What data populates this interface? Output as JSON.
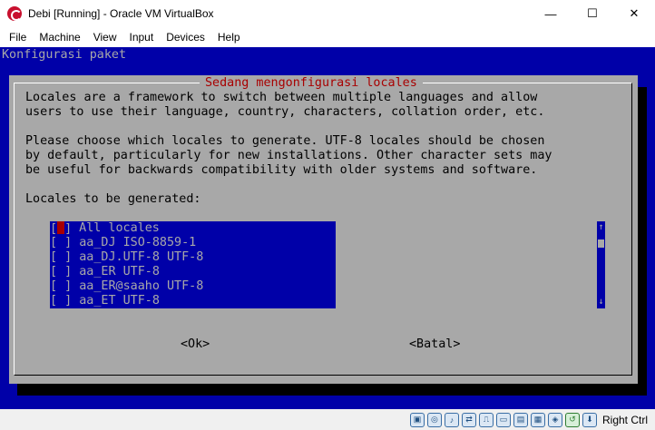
{
  "window": {
    "title": "Debi [Running] - Oracle VM VirtualBox",
    "controls": {
      "minimize": "—",
      "maximize": "☐",
      "close": "✕"
    }
  },
  "menubar": {
    "items": [
      {
        "label": "File"
      },
      {
        "label": "Machine"
      },
      {
        "label": "View"
      },
      {
        "label": "Input"
      },
      {
        "label": "Devices"
      },
      {
        "label": "Help"
      }
    ]
  },
  "vm": {
    "header": "Konfigurasi paket",
    "dialog": {
      "title": "Sedang mengonfigurasi locales",
      "lines": [
        "Locales are a framework to switch between multiple languages and allow",
        "users to use their language, country, characters, collation order, etc.",
        "",
        "Please choose which locales to generate. UTF-8 locales should be chosen",
        "by default, particularly for new installations. Other character sets may",
        "be useful for backwards compatibility with older systems and software.",
        "",
        "Locales to be generated:"
      ],
      "locales": [
        {
          "checkbox_left": "[",
          "checkbox_right": "]",
          "label": " All locales",
          "cursor": true
        },
        {
          "checkbox_left": "[ ",
          "checkbox_right": "]",
          "label": " aa_DJ ISO-8859-1",
          "cursor": false
        },
        {
          "checkbox_left": "[ ",
          "checkbox_right": "]",
          "label": " aa_DJ.UTF-8 UTF-8",
          "cursor": false
        },
        {
          "checkbox_left": "[ ",
          "checkbox_right": "]",
          "label": " aa_ER UTF-8",
          "cursor": false
        },
        {
          "checkbox_left": "[ ",
          "checkbox_right": "]",
          "label": " aa_ER@saaho UTF-8",
          "cursor": false
        },
        {
          "checkbox_left": "[ ",
          "checkbox_right": "]",
          "label": " aa_ET UTF-8",
          "cursor": false
        }
      ],
      "scroll": {
        "up": "↑",
        "down": "↓"
      },
      "ok_label": "<Ok>",
      "cancel_label": "<Batal>"
    }
  },
  "statusbar": {
    "icons": [
      {
        "name": "hard-disk-icon",
        "glyph": "▣"
      },
      {
        "name": "optical-drive-icon",
        "glyph": "◎"
      },
      {
        "name": "audio-icon",
        "glyph": "♪"
      },
      {
        "name": "network-icon",
        "glyph": "⇄"
      },
      {
        "name": "usb-icon",
        "glyph": "⎍"
      },
      {
        "name": "shared-folders-icon",
        "glyph": "▭"
      },
      {
        "name": "display-icon",
        "glyph": "▤"
      },
      {
        "name": "video-capture-icon",
        "glyph": "▦"
      },
      {
        "name": "cpu-icon",
        "glyph": "◈"
      },
      {
        "name": "guest-additions-icon",
        "glyph": "↺"
      },
      {
        "name": "mouse-integration-icon",
        "glyph": "⬇"
      }
    ],
    "host_key": "Right Ctrl"
  }
}
